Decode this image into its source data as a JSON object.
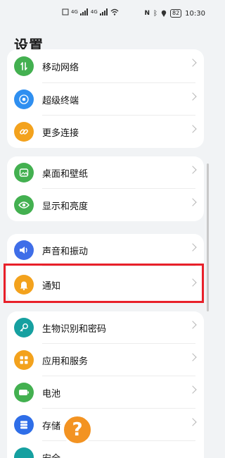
{
  "status_bar": {
    "signal_1": "4G",
    "signal_2": "4G",
    "battery": "82",
    "time": "10:30"
  },
  "page_title": "设置",
  "groups": [
    {
      "items": [
        {
          "label": "移动网络",
          "icon": "mobile-network-icon",
          "color": "#43b050"
        },
        {
          "label": "超级终端",
          "icon": "super-device-icon",
          "color": "#2f8ff0"
        },
        {
          "label": "更多连接",
          "icon": "link-icon",
          "color": "#f3a21d"
        }
      ]
    },
    {
      "items": [
        {
          "label": "桌面和壁纸",
          "icon": "wallpaper-icon",
          "color": "#43b050"
        },
        {
          "label": "显示和亮度",
          "icon": "eye-icon",
          "color": "#43b050"
        }
      ]
    },
    {
      "items": [
        {
          "label": "声音和振动",
          "icon": "volume-icon",
          "color": "#3f6ee8"
        },
        {
          "label": "通知",
          "icon": "bell-icon",
          "color": "#f3a21d"
        }
      ]
    },
    {
      "items": [
        {
          "label": "生物识别和密码",
          "icon": "key-icon",
          "color": "#16a0a0"
        },
        {
          "label": "应用和服务",
          "icon": "apps-icon",
          "color": "#f3a21d"
        },
        {
          "label": "电池",
          "icon": "battery-icon",
          "color": "#43b050"
        },
        {
          "label": "存储",
          "icon": "storage-icon",
          "color": "#2f6ee8"
        },
        {
          "label": "安全",
          "icon": "security-icon",
          "color": "#16a0a0"
        }
      ]
    }
  ],
  "help_button": {
    "glyph": "?",
    "color": "#f39322"
  },
  "highlight_color": "#e8202a"
}
